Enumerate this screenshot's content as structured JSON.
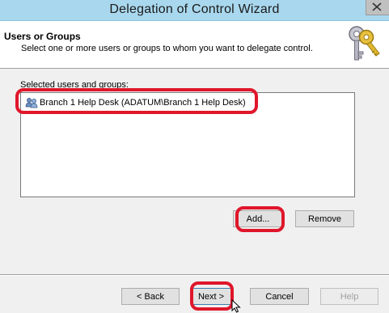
{
  "window": {
    "title": "Delegation of Control Wizard"
  },
  "header": {
    "title": "Users or Groups",
    "description": "Select one or more users or groups to whom you want to delegate control."
  },
  "selected_group_label": "Selected users and groups:",
  "selected_items": [
    {
      "label": "Branch 1 Help Desk (ADATUM\\Branch 1 Help Desk)",
      "icon": "user-group-icon"
    }
  ],
  "buttons": {
    "add": "Add...",
    "remove": "Remove",
    "back": "< Back",
    "next": "Next >",
    "cancel": "Cancel",
    "help": "Help"
  },
  "colors": {
    "titlebar": "#a9d8ee",
    "highlight": "#e0162b"
  }
}
